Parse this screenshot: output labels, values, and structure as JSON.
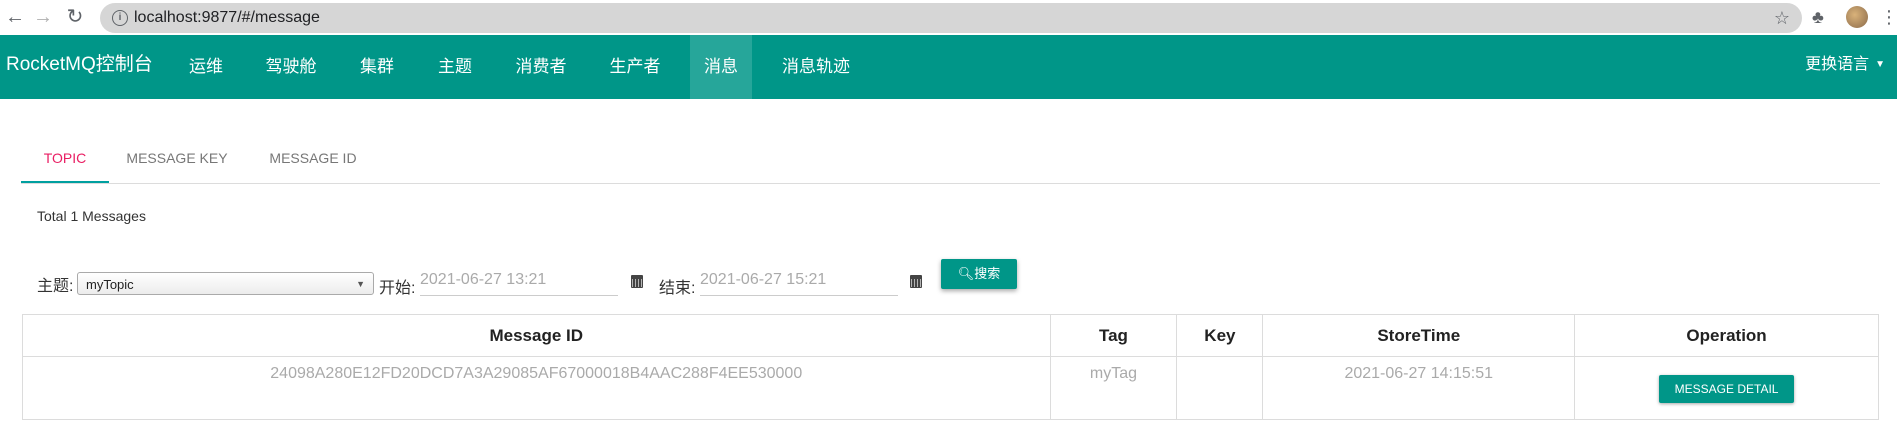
{
  "browser": {
    "url": "localhost:9877/#/message"
  },
  "navbar": {
    "brand": "RocketMQ控制台",
    "items": [
      "运维",
      "驾驶舱",
      "集群",
      "主题",
      "消费者",
      "生产者",
      "消息",
      "消息轨迹"
    ],
    "active_index": 6,
    "language": "更换语言"
  },
  "tabs": {
    "items": [
      "TOPIC",
      "MESSAGE KEY",
      "MESSAGE ID"
    ],
    "active_index": 0
  },
  "summary": "Total 1 Messages",
  "search": {
    "topic_label": "主题:",
    "topic_value": "myTopic",
    "start_label": "开始:",
    "start_value": "2021-06-27 13:21",
    "end_label": "结束:",
    "end_value": "2021-06-27 15:21",
    "search_button": "搜索"
  },
  "table": {
    "headers": [
      "Message ID",
      "Tag",
      "Key",
      "StoreTime",
      "Operation"
    ],
    "rows": [
      {
        "message_id": "24098A280E12FD20DCD7A3A29085AF67000018B4AAC288F4EE530000",
        "tag": "myTag",
        "key": "",
        "store_time": "2021-06-27 14:15:51",
        "operation": "MESSAGE DETAIL"
      }
    ]
  },
  "colors": {
    "primary": "#009688",
    "active_nav": "#26a69a",
    "active_tab": "#e91e63"
  }
}
